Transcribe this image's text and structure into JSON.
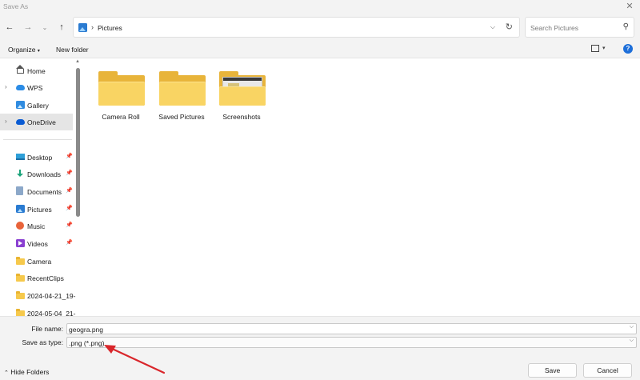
{
  "window": {
    "title": "Save As"
  },
  "nav": {
    "breadcrumb": "Pictures",
    "search_placeholder": "Search Pictures"
  },
  "toolbar": {
    "organize_label": "Organize",
    "new_folder_label": "New folder"
  },
  "sidebar": {
    "items": [
      {
        "label": "Home",
        "icon": "home-icon"
      },
      {
        "label": "WPS",
        "icon": "cloud-icon"
      },
      {
        "label": "Gallery",
        "icon": "gallery-icon"
      },
      {
        "label": "OneDrive",
        "icon": "onedrive-icon"
      },
      {
        "label": "Desktop",
        "icon": "desktop-icon"
      },
      {
        "label": "Downloads",
        "icon": "downloads-icon"
      },
      {
        "label": "Documents",
        "icon": "documents-icon"
      },
      {
        "label": "Pictures",
        "icon": "pictures-icon"
      },
      {
        "label": "Music",
        "icon": "music-icon"
      },
      {
        "label": "Videos",
        "icon": "videos-icon"
      },
      {
        "label": "Camera",
        "icon": "folder-icon"
      },
      {
        "label": "RecentClips",
        "icon": "folder-icon"
      },
      {
        "label": "2024-04-21_19-",
        "icon": "folder-icon"
      },
      {
        "label": "2024-05-04_21-",
        "icon": "folder-icon"
      }
    ]
  },
  "content": {
    "folders": [
      {
        "name": "Camera Roll"
      },
      {
        "name": "Saved Pictures"
      },
      {
        "name": "Screenshots"
      }
    ]
  },
  "form": {
    "file_name_label": "File name:",
    "file_name_value": "geogra.png",
    "save_type_label": "Save as type:",
    "save_type_value": ".png (*.png)"
  },
  "footer": {
    "hide_folders_label": "Hide Folders",
    "save_label": "Save",
    "cancel_label": "Cancel"
  },
  "colors": {
    "accent": "#1e6fd9",
    "folder": "#f9d463",
    "annotation_arrow": "#d9262b"
  }
}
